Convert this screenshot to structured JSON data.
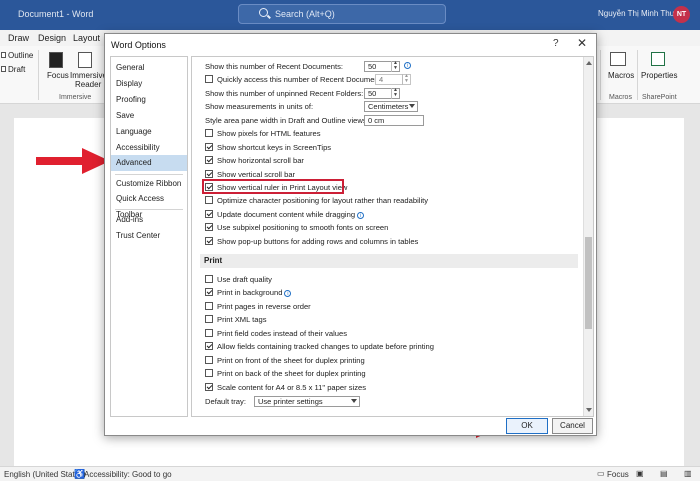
{
  "word": {
    "doc_title": "Document1 - Word",
    "search_placeholder": "Search (Alt+Q)",
    "user_name": "Nguyễn Thị Minh Thư",
    "user_initials": "NT",
    "tabs": [
      "Draw",
      "Design",
      "Layout"
    ],
    "ribbon": {
      "outline": "Outline",
      "draft": "Draft",
      "focus": "Focus",
      "immersive_reader_1": "Immersive",
      "immersive_reader_2": "Reader",
      "immersive_group": "Immersive",
      "macros": "Macros",
      "macros_group": "Macros",
      "properties": "Properties",
      "sharepoint_group": "SharePoint"
    },
    "status": {
      "language": "English (United States)",
      "accessibility": "Accessibility: Good to go",
      "focus": "Focus"
    }
  },
  "dialog": {
    "title": "Word Options",
    "help": "?",
    "close": "✕",
    "nav": [
      {
        "label": "General",
        "selected": false
      },
      {
        "label": "Display",
        "selected": false
      },
      {
        "label": "Proofing",
        "selected": false
      },
      {
        "label": "Save",
        "selected": false
      },
      {
        "label": "Language",
        "selected": false
      },
      {
        "label": "Accessibility",
        "selected": false
      },
      {
        "label": "Advanced",
        "selected": true
      },
      {
        "label": "Customize Ribbon",
        "selected": false
      },
      {
        "label": "Quick Access Toolbar",
        "selected": false
      },
      {
        "label": "Add-ins",
        "selected": false
      },
      {
        "label": "Trust Center",
        "selected": false
      }
    ],
    "display": {
      "recent_docs_label": "Show this number of Recent Documents:",
      "recent_docs_value": "50",
      "quick_access_label": "Quickly access this number of Recent Documents:",
      "quick_access_value": "4",
      "unpinned_label": "Show this number of unpinned Recent Folders:",
      "unpinned_value": "50",
      "units_label": "Show measurements in units of:",
      "units_value": "Centimeters",
      "style_area_label": "Style area pane width in Draft and Outline views:",
      "style_area_value": "0 cm",
      "checkboxes": [
        {
          "label": "Show pixels for HTML features",
          "checked": false
        },
        {
          "label": "Show shortcut keys in ScreenTips",
          "checked": true
        },
        {
          "label": "Show horizontal scroll bar",
          "checked": true
        },
        {
          "label": "Show vertical scroll bar",
          "checked": true
        },
        {
          "label": "Show vertical ruler in Print Layout view",
          "checked": true
        },
        {
          "label": "Optimize character positioning for layout rather than readability",
          "checked": false
        },
        {
          "label": "Update document content while dragging",
          "checked": true
        },
        {
          "label": "Use subpixel positioning to smooth fonts on screen",
          "checked": true
        },
        {
          "label": "Show pop-up buttons for adding rows and columns in tables",
          "checked": true
        }
      ]
    },
    "print": {
      "heading": "Print",
      "checkboxes": [
        {
          "label": "Use draft quality",
          "checked": false
        },
        {
          "label": "Print in background",
          "checked": true
        },
        {
          "label": "Print pages in reverse order",
          "checked": false
        },
        {
          "label": "Print XML tags",
          "checked": false
        },
        {
          "label": "Print field codes instead of their values",
          "checked": false
        },
        {
          "label": "Allow fields containing tracked changes to update before printing",
          "checked": true
        },
        {
          "label": "Print on front of the sheet for duplex printing",
          "checked": false
        },
        {
          "label": "Print on back of the sheet for duplex printing",
          "checked": false
        },
        {
          "label": "Scale content for A4 or 8.5 x 11\" paper sizes",
          "checked": true
        }
      ],
      "default_tray_label": "Default tray:",
      "default_tray_value": "Use printer settings"
    },
    "ok": "OK",
    "cancel": "Cancel"
  },
  "colors": {
    "word_blue": "#2b579a",
    "highlight_red": "#cc1f36",
    "selected_nav": "#c7dcf0"
  }
}
